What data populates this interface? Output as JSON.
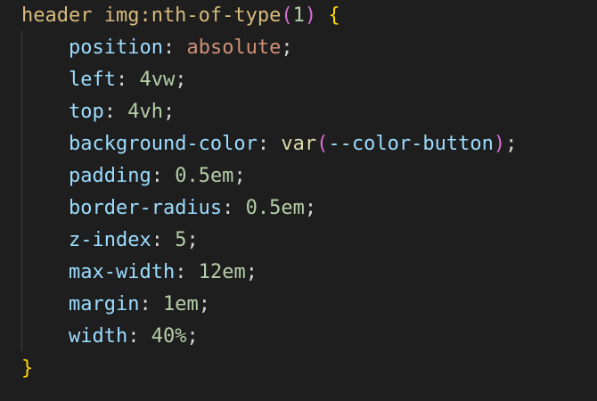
{
  "editor": {
    "selector": "header img:nth-of-type",
    "selector_paren_open": "(",
    "selector_arg": "1",
    "selector_paren_close": ")",
    "open_brace": "{",
    "close_brace": "}",
    "declarations": [
      {
        "property": "position",
        "value": "absolute",
        "value_kind": "string"
      },
      {
        "property": "left",
        "value": "4vw",
        "value_kind": "number"
      },
      {
        "property": "top",
        "value": "4vh",
        "value_kind": "number"
      },
      {
        "property": "background-color",
        "value_func": "var",
        "value_paren_open": "(",
        "value_arg": "--color-button",
        "value_paren_close": ")",
        "value_kind": "function"
      },
      {
        "property": "padding",
        "value": "0.5em",
        "value_kind": "number"
      },
      {
        "property": "border-radius",
        "value": "0.5em",
        "value_kind": "number"
      },
      {
        "property": "z-index",
        "value": "5",
        "value_kind": "number"
      },
      {
        "property": "max-width",
        "value": "12em",
        "value_kind": "number"
      },
      {
        "property": "margin",
        "value": "1em",
        "value_kind": "number"
      },
      {
        "property": "width",
        "value": "40%",
        "value_kind": "number"
      }
    ],
    "colon": ":",
    "semicolon": ";"
  }
}
